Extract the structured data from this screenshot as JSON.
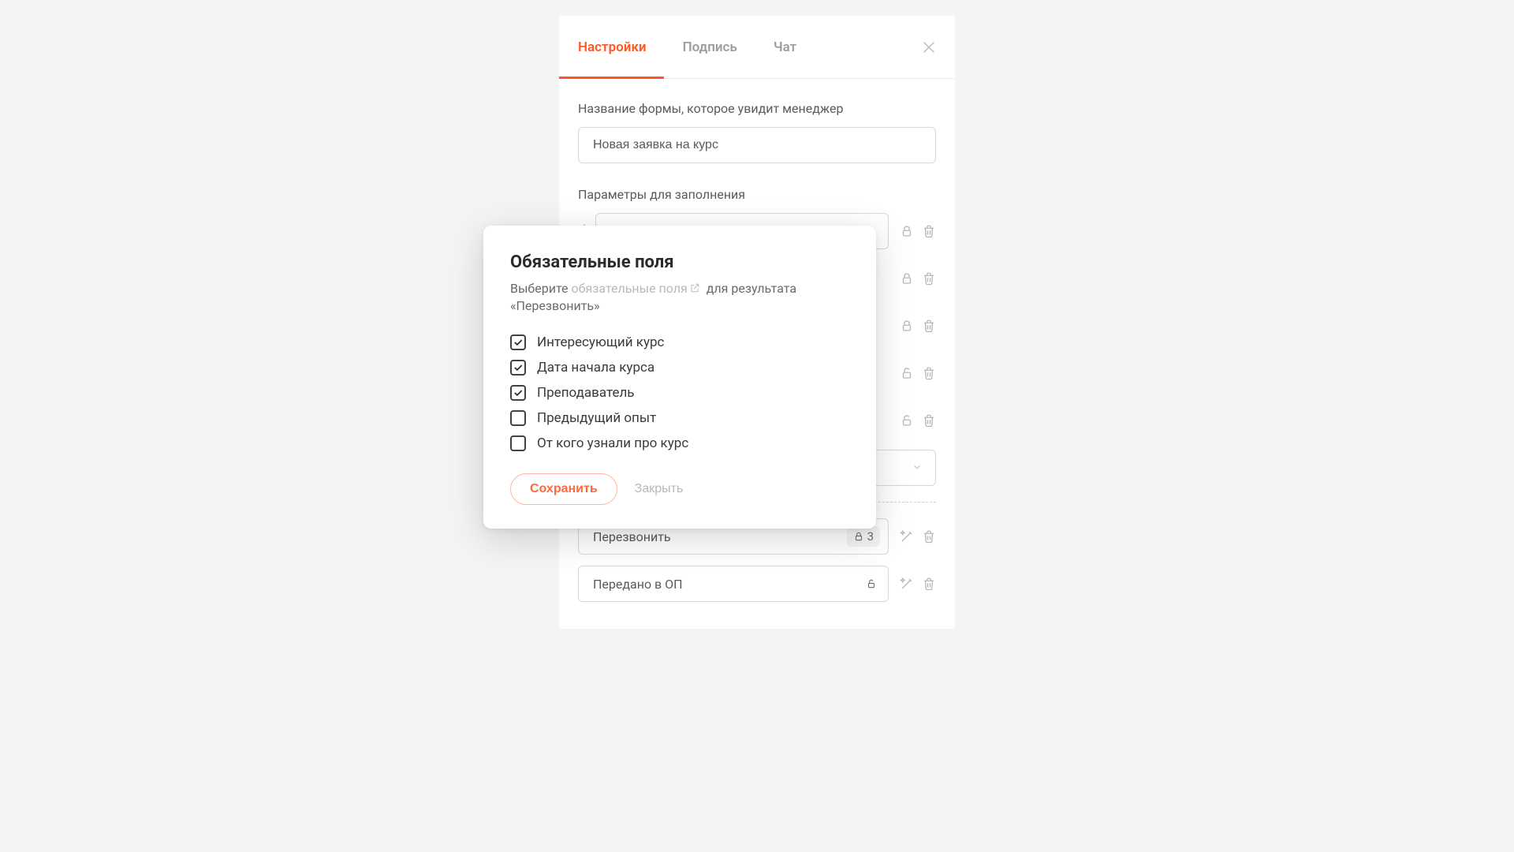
{
  "tabs": {
    "settings": "Настройки",
    "signature": "Подпись",
    "chat": "Чат"
  },
  "form": {
    "nameLabel": "Название формы, которое увидит менеджер",
    "nameValue": "Новая заявка на курс",
    "paramsLabel": "Параметры для заполнения"
  },
  "params": {
    "p0": "Интересующий курс"
  },
  "results": {
    "r0": {
      "label": "Перезвонить",
      "count": "3"
    },
    "r1": {
      "label": "Передано в ОП"
    }
  },
  "popover": {
    "title": "Обязательные поля",
    "sub_pre": "Выберите ",
    "sub_link": "обязательные поля",
    "sub_post": " для результата «Перезвонить»",
    "items": {
      "i0": {
        "label": "Интересующий курс",
        "checked": true
      },
      "i1": {
        "label": "Дата начала курса",
        "checked": true
      },
      "i2": {
        "label": "Преподаватель",
        "checked": true
      },
      "i3": {
        "label": "Предыдущий опыт",
        "checked": false
      },
      "i4": {
        "label": "От кого узнали про курс",
        "checked": false
      }
    },
    "save": "Сохранить",
    "close": "Закрыть"
  }
}
